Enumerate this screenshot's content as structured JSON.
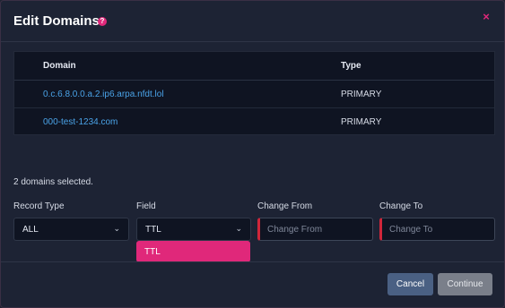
{
  "dialog": {
    "title": "Edit Domains",
    "help_icon": "question-circle-icon",
    "close_icon": "close-icon",
    "close_glyph": "×",
    "help_glyph": "?"
  },
  "table": {
    "headers": {
      "domain": "Domain",
      "type": "Type"
    },
    "rows": [
      {
        "domain": "0.c.6.8.0.0.a.2.ip6.arpa.nfdt.lol",
        "type": "PRIMARY"
      },
      {
        "domain": "000-test-1234.com",
        "type": "PRIMARY"
      }
    ]
  },
  "selection": {
    "text": "2 domains selected."
  },
  "form": {
    "record_type": {
      "label": "Record Type",
      "value": "ALL"
    },
    "field": {
      "label": "Field",
      "value": "TTL",
      "options": [
        "TTL"
      ]
    },
    "change_from": {
      "label": "Change From",
      "placeholder": "Change From"
    },
    "change_to": {
      "label": "Change To",
      "placeholder": "Change To"
    },
    "chevron_glyph": "⌄"
  },
  "buttons": {
    "cancel": "Cancel",
    "continue": "Continue"
  },
  "colors": {
    "accent": "#e0287a",
    "link": "#4aa3e8",
    "error_border": "#d0263a",
    "cancel_bg": "#4a6083",
    "continue_bg": "#7a7f8a"
  }
}
